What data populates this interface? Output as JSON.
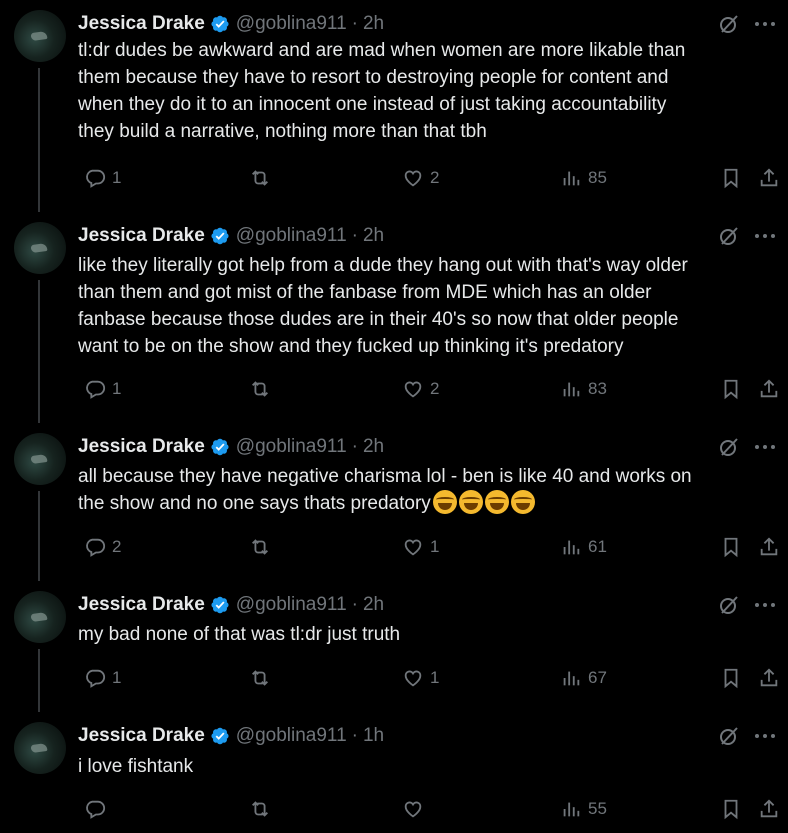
{
  "author": {
    "name": "Jessica Drake",
    "handle": "@goblina911",
    "separator": "·"
  },
  "colors": {
    "background": "#000000",
    "text": "#e7e9ea",
    "muted": "#71767b",
    "verified": "#1d9bf0",
    "thread_line": "#333639"
  },
  "icons": {
    "verified": "verified-badge-icon",
    "grok": "grok-icon",
    "more": "more-options-icon",
    "reply": "reply-icon",
    "retweet": "retweet-icon",
    "like": "like-icon",
    "views": "views-icon",
    "bookmark": "bookmark-icon",
    "share": "share-icon"
  },
  "tweets": [
    {
      "time": "2h",
      "lines": [
        "tl:dr dudes be awkward and are mad when women are more likable than",
        "them because they have to resort to destroying people for content and",
        "when they do it to an innocent one instead of just taking accountability",
        "they build a narrative, nothing more than that tbh"
      ],
      "replies": "1",
      "retweets": "",
      "likes": "2",
      "views": "85"
    },
    {
      "time": "2h",
      "lines": [
        "like they literally got help from a dude they hang out with that's way older",
        "than them and got mist of the fanbase from MDE which has an older",
        "fanbase because those dudes are in their 40's so now that older people",
        "want to be on the show and they fucked up thinking it's predatory"
      ],
      "replies": "1",
      "retweets": "",
      "likes": "2",
      "views": "83"
    },
    {
      "time": "2h",
      "lines": [
        "all because they have negative charisma lol - ben is like 40 and works on",
        "the show and no one says thats predatory"
      ],
      "emoji_count": 4,
      "emoji_name": "face-with-tears-of-joy-emoji",
      "replies": "2",
      "retweets": "",
      "likes": "1",
      "views": "61"
    },
    {
      "time": "2h",
      "lines": [
        "my bad none of that was tl:dr just truth"
      ],
      "replies": "1",
      "retweets": "",
      "likes": "1",
      "views": "67"
    },
    {
      "time": "1h",
      "lines": [
        "i love fishtank"
      ],
      "replies": "",
      "retweets": "",
      "likes": "",
      "views": "55"
    }
  ]
}
